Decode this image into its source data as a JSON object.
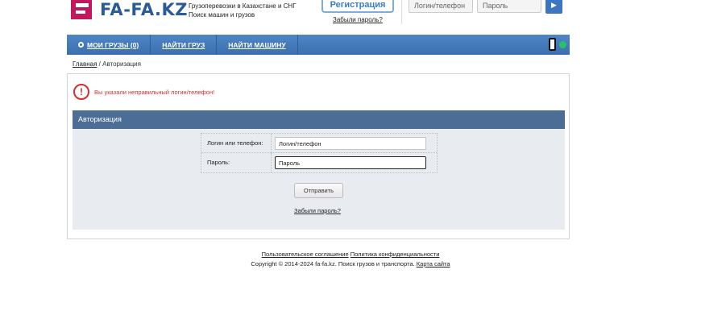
{
  "header": {
    "logo_text": "FA-FA.KZ",
    "tagline_line1": "Грузоперевозки в Казахстане и СНГ",
    "tagline_line2": "Поиск машин и грузов",
    "register_label": "Регистрация",
    "forgot_password": "Забыли пароль?",
    "login_placeholder": "Логин/телефон",
    "password_placeholder": "Пароль",
    "submit_glyph": "▶"
  },
  "nav": {
    "items": [
      {
        "label": "МОИ ГРУЗЫ (0)"
      },
      {
        "label": "НАЙТИ ГРУЗ"
      },
      {
        "label": "НАЙТИ МАШИНУ"
      }
    ]
  },
  "breadcrumb": {
    "home": "Главная",
    "separator": " / ",
    "current": "Авторизация"
  },
  "error": {
    "icon_glyph": "!",
    "message": "Вы указали неправильный логин/телефон!"
  },
  "auth": {
    "title": "Авторизация",
    "login_label": "Логин или телефон:",
    "login_value": "Логин/телефон",
    "password_label": "Пароль:",
    "password_value": "Пароль",
    "submit_label": "Отправить",
    "forgot_password": "Забыли пароль?"
  },
  "footer": {
    "terms": "Пользовательское соглашение",
    "privacy": "Политика конфиденциальности",
    "copyright": "Copyright © 2014-2024 fa-fa.kz. Поиск грузов и транспорта. ",
    "sitemap": "Карта сайта"
  },
  "colors": {
    "brand_blue": "#2a5b96",
    "brand_magenta": "#c2185b",
    "nav_blue": "#3c6fae",
    "error_red": "#d32f2f",
    "auth_header": "#4b6d96"
  }
}
